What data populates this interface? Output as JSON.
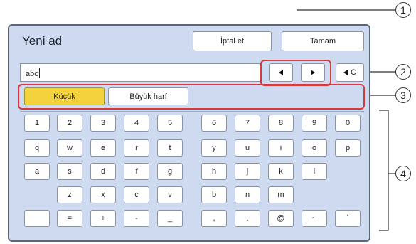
{
  "header": {
    "title": "Yeni ad",
    "cancel_label": "İptal et",
    "ok_label": "Tamam"
  },
  "input": {
    "value": "abc"
  },
  "cursor": {
    "left_icon": "arrow-left-icon",
    "right_icon": "arrow-right-icon"
  },
  "backspace": {
    "label": "C",
    "icon": "backspace-arrow-icon"
  },
  "modes": {
    "small_label": "Küçük",
    "caps_label": "Büyük harf",
    "active": "Küçük",
    "active_color": "#f2d23d"
  },
  "keyboard": {
    "row1": [
      "1",
      "2",
      "3",
      "4",
      "5",
      "6",
      "7",
      "8",
      "9",
      "0"
    ],
    "row2": [
      "q",
      "w",
      "e",
      "r",
      "t",
      "y",
      "u",
      "ı",
      "o",
      "p"
    ],
    "row3": [
      "a",
      "s",
      "d",
      "f",
      "g",
      "h",
      "j",
      "k",
      "l"
    ],
    "row4": [
      "z",
      "x",
      "c",
      "v",
      "b",
      "n",
      "m"
    ],
    "row5": [
      "",
      "=",
      "+",
      "-",
      "_",
      ",",
      ".",
      "@",
      "~",
      "`"
    ]
  },
  "callouts": [
    "1",
    "2",
    "3",
    "4"
  ],
  "colors": {
    "callout_highlight": "#d63a3a",
    "panel": "#cddaf0"
  }
}
